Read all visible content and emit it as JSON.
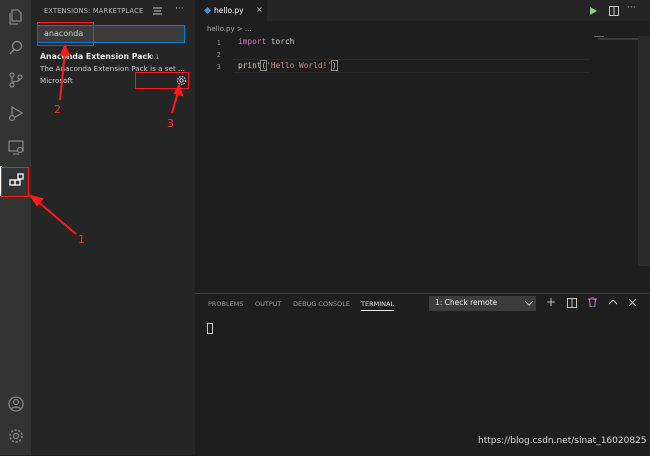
{
  "sidebar": {
    "title": "EXTENSIONS: MARKETPLACE",
    "search_value": "anaconda",
    "extension": {
      "name": "Anaconda Extension Pack",
      "version": "1.0.1",
      "description": "The Anaconda Extension Pack is a set ...",
      "publisher": "Microsoft"
    }
  },
  "editor": {
    "tab_label": "hello.py",
    "tab_close": "×",
    "breadcrumb": "hello.py > ...",
    "lines": [
      {
        "num": "1",
        "kw": "import",
        "rest": " torch"
      },
      {
        "num": "2"
      },
      {
        "num": "3",
        "fn": "print",
        "p1": "(",
        "str": "'Hello World!'",
        "p2": ")"
      }
    ]
  },
  "panel": {
    "tabs": [
      "PROBLEMS",
      "OUTPUT",
      "DEBUG CONSOLE",
      "TERMINAL"
    ],
    "terminal_select": "1: Check remote",
    "plus": "+"
  },
  "annotations": {
    "n1": "1",
    "n2": "2",
    "n3": "3"
  },
  "watermark": "https://blog.csdn.net/sinat_16020825",
  "colors": {
    "accent": "#007fd4",
    "annotation": "#ff1a1a",
    "keyword": "#c586c0",
    "function": "#dcdcaa",
    "string": "#ce9178"
  }
}
